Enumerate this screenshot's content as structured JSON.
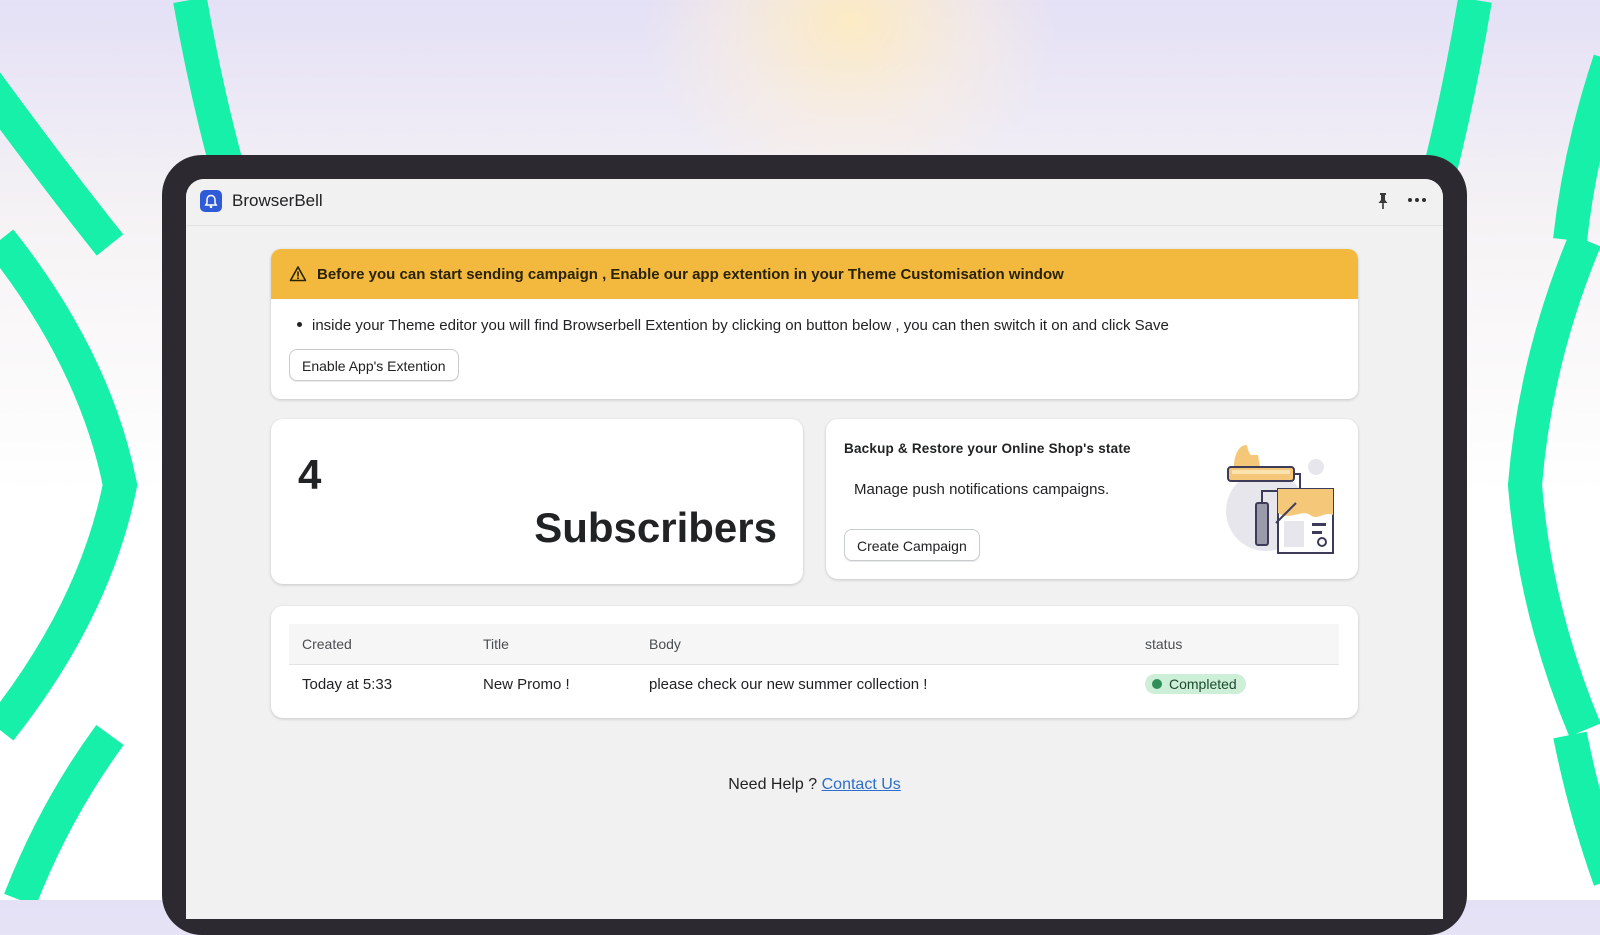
{
  "app": {
    "title": "BrowserBell",
    "logo_icon": "bell-icon",
    "accent_color": "#2f5bd9",
    "actions": [
      {
        "icon": "pin-icon"
      },
      {
        "icon": "more-horizontal-icon"
      }
    ]
  },
  "banner": {
    "title": "Before you can start sending campaign , Enable our app extention in your Theme Customisation window",
    "icon": "warning-icon",
    "color": "#f2b93e",
    "item": "inside your Theme editor you will find Browserbell Extention by clicking on button below , you can then switch it on and click Save",
    "button_label": "Enable App's Extention"
  },
  "subscribers": {
    "count": "4",
    "label": "Subscribers"
  },
  "backup": {
    "title": "Backup & Restore your Online Shop's state",
    "subtitle": "Manage push notifications campaigns.",
    "button_label": "Create Campaign",
    "illustration_icon": "paint-roller-icon"
  },
  "campaigns": {
    "columns": [
      "Created",
      "Title",
      "Body",
      "status"
    ],
    "rows": [
      {
        "created": "Today at 5:33",
        "title": "New Promo !",
        "body": "please check our new summer collection !",
        "status": "Completed",
        "status_color": "#2f8f58"
      }
    ]
  },
  "help": {
    "text": "Need Help ?",
    "link_label": "Contact Us",
    "link_color": "#2c6ecb"
  },
  "background": {
    "accent_color": "#16f0a8"
  }
}
